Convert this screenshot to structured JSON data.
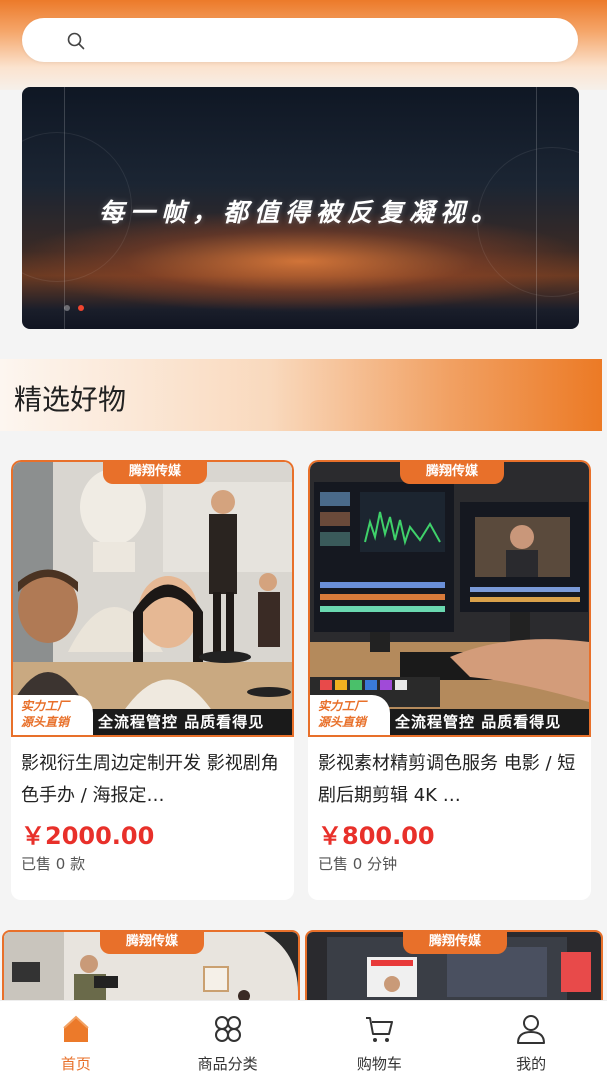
{
  "search": {
    "placeholder": ""
  },
  "banner": {
    "headline": "每一帧，都值得被反复凝视。",
    "slides": 2,
    "active_slide": 2
  },
  "section": {
    "title": "精选好物"
  },
  "products": [
    {
      "brand": "腾翔传媒",
      "factory_tag_line1": "实力工厂",
      "factory_tag_line2": "源头直销",
      "slogan": "全流程管控 品质看得见",
      "title": "影视衍生周边定制开发 影视剧角色手办 / 海报定…",
      "price": "￥2000.00",
      "sold": "已售 0 款"
    },
    {
      "brand": "腾翔传媒",
      "factory_tag_line1": "实力工厂",
      "factory_tag_line2": "源头直销",
      "slogan": "全流程管控 品质看得见",
      "title": "影视素材精剪调色服务 电影 / 短剧后期剪辑 4K …",
      "price": "￥800.00",
      "sold": "已售 0 分钟"
    },
    {
      "brand": "腾翔传媒"
    },
    {
      "brand": "腾翔传媒"
    }
  ],
  "tabbar": [
    {
      "label": "首页",
      "icon": "home-icon",
      "active": true
    },
    {
      "label": "商品分类",
      "icon": "category-grid-icon",
      "active": false
    },
    {
      "label": "购物车",
      "icon": "cart-icon",
      "active": false
    },
    {
      "label": "我的",
      "icon": "user-icon",
      "active": false
    }
  ],
  "colors": {
    "accent": "#e8702a",
    "price": "#e8302a",
    "active_dot": "#f0452f"
  }
}
